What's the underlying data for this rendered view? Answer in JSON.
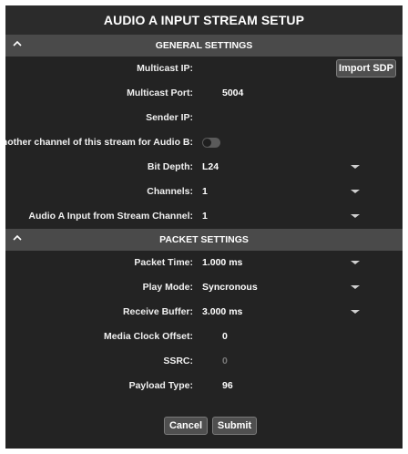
{
  "title": "AUDIO A INPUT STREAM SETUP",
  "general": {
    "header": "GENERAL SETTINGS",
    "multicast_ip_label": "Multicast IP:",
    "multicast_ip_value": "",
    "import_sdp_label": "Import SDP",
    "multicast_port_label": "Multicast Port:",
    "multicast_port_value": "5004",
    "sender_ip_label": "Sender IP:",
    "sender_ip_value": "",
    "select_channel_label": "Select another channel of this stream for Audio B:",
    "select_channel_enabled": false,
    "bit_depth_label": "Bit Depth:",
    "bit_depth_value": "L24",
    "channels_label": "Channels:",
    "channels_value": "1",
    "input_channel_label": "Audio A Input from Stream Channel:",
    "input_channel_value": "1"
  },
  "packet": {
    "header": "PACKET SETTINGS",
    "packet_time_label": "Packet Time:",
    "packet_time_value": "1.000 ms",
    "play_mode_label": "Play Mode:",
    "play_mode_value": "Syncronous",
    "receive_buffer_label": "Receive Buffer:",
    "receive_buffer_value": "3.000 ms",
    "media_clock_offset_label": "Media Clock Offset:",
    "media_clock_offset_value": "0",
    "ssrc_label": "SSRC:",
    "ssrc_value": "0",
    "payload_type_label": "Payload Type:",
    "payload_type_value": "96"
  },
  "footer": {
    "cancel_label": "Cancel",
    "submit_label": "Submit"
  },
  "icons": {
    "collapse": "chevron-up-icon",
    "dropdown": "caret-down-icon"
  }
}
